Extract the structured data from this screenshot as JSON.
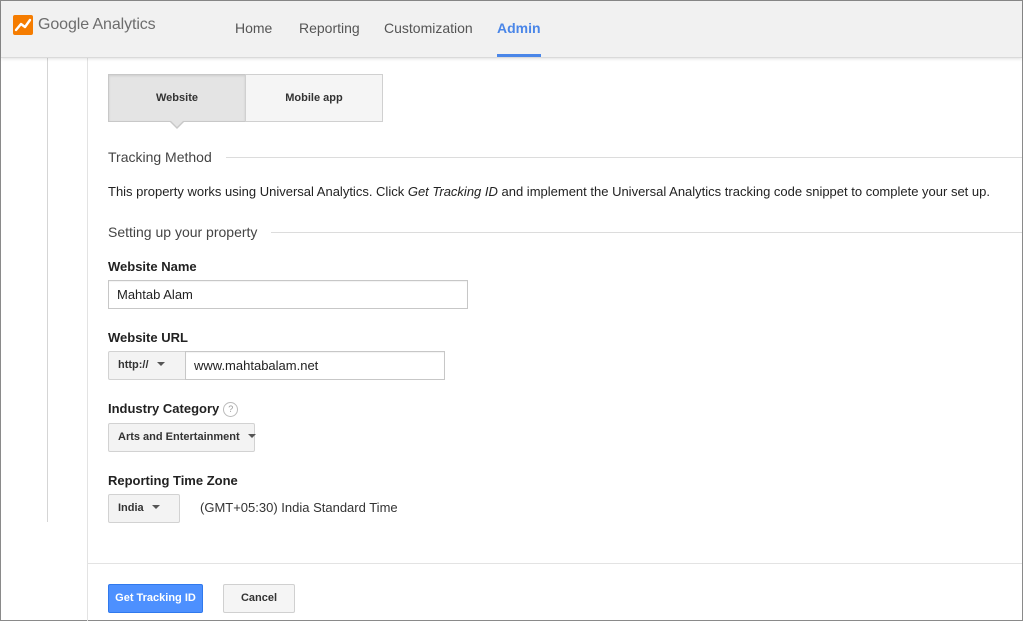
{
  "header": {
    "brand": "Google Analytics",
    "nav": [
      {
        "label": "Home"
      },
      {
        "label": "Reporting"
      },
      {
        "label": "Customization"
      },
      {
        "label": "Admin",
        "active": true
      }
    ]
  },
  "property_type": {
    "options": [
      "Website",
      "Mobile app"
    ],
    "selected": "Website"
  },
  "tracking_method": {
    "heading": "Tracking Method",
    "text_before": "This property works using Universal Analytics. Click ",
    "text_emphasis": "Get Tracking ID",
    "text_after": " and implement the Universal Analytics tracking code snippet to complete your set up."
  },
  "setup": {
    "heading": "Setting up your property",
    "website_name": {
      "label": "Website Name",
      "value": "Mahtab Alam"
    },
    "website_url": {
      "label": "Website URL",
      "protocol": "http://",
      "value": "www.mahtabalam.net"
    },
    "industry": {
      "label": "Industry Category",
      "help": "?",
      "value": "Arts and Entertainment"
    },
    "timezone": {
      "label": "Reporting Time Zone",
      "country": "India",
      "zone": "(GMT+05:30) India Standard Time"
    }
  },
  "actions": {
    "primary": "Get Tracking ID",
    "cancel": "Cancel"
  },
  "colors": {
    "accent": "#4a86e8",
    "primary_button": "#4d90fe",
    "logo_orange": "#f57c00"
  }
}
